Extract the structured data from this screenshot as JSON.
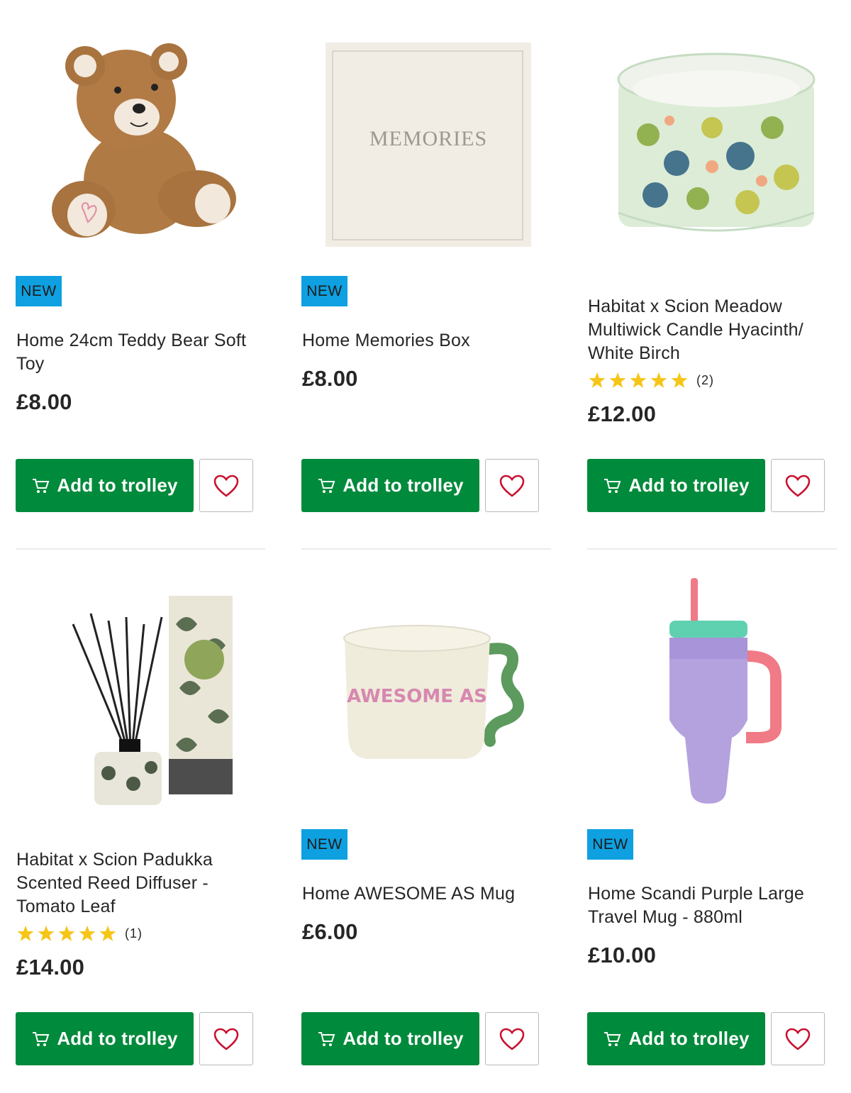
{
  "colors": {
    "primary_green": "#008a3b",
    "badge_blue": "#0ea0e0",
    "heart_red": "#c8102e",
    "star_yellow": "#f5c518"
  },
  "products": [
    {
      "badge": "NEW",
      "title_lines": [
        "Home 24cm Teddy Bear Soft",
        "Toy"
      ],
      "price": "£8.00",
      "rating": null,
      "image_icon": "teddy-bear",
      "add_label": "Add to trolley"
    },
    {
      "badge": "NEW",
      "title_lines": [
        "Home Memories Box"
      ],
      "price": "£8.00",
      "rating": null,
      "image_icon": "memories-box",
      "image_text": "MEMORIES",
      "add_label": "Add to trolley"
    },
    {
      "badge": null,
      "title_lines": [
        "Habitat x Scion Meadow",
        "Multiwick Candle Hyacinth/",
        "White Birch"
      ],
      "price": "£12.00",
      "rating": {
        "stars": 5,
        "count": "(2)"
      },
      "image_icon": "floral-candle",
      "add_label": "Add to trolley"
    },
    {
      "badge": null,
      "title_lines": [
        "Habitat x Scion Padukka",
        "Scented Reed Diffuser -",
        "Tomato Leaf"
      ],
      "price": "£14.00",
      "rating": {
        "stars": 5,
        "count": "(1)"
      },
      "image_icon": "reed-diffuser",
      "add_label": "Add to trolley"
    },
    {
      "badge": "NEW",
      "title_lines": [
        "Home AWESOME AS Mug"
      ],
      "price": "£6.00",
      "rating": null,
      "image_icon": "mug",
      "image_text": "AWESOME AS",
      "add_label": "Add to trolley"
    },
    {
      "badge": "NEW",
      "title_lines": [
        "Home Scandi Purple Large",
        "Travel Mug - 880ml"
      ],
      "price": "£10.00",
      "rating": null,
      "image_icon": "travel-mug",
      "add_label": "Add to trolley"
    }
  ]
}
